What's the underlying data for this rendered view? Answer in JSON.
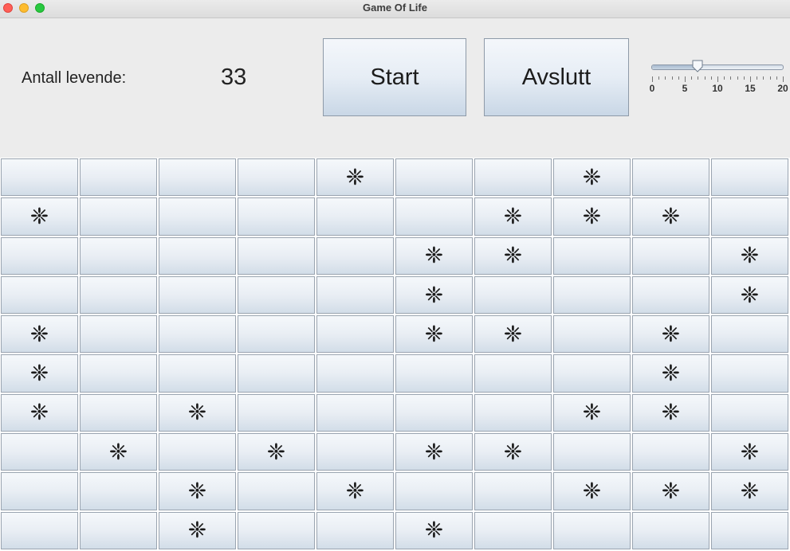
{
  "window": {
    "title": "Game Of Life"
  },
  "controls": {
    "alive_label": "Antall levende:",
    "alive_count": "33",
    "start_label": "Start",
    "quit_label": "Avslutt",
    "speed_slider": {
      "min": 0,
      "max": 20,
      "value": 7,
      "major_tick_labels": [
        "0",
        "5",
        "10",
        "15",
        "20"
      ]
    }
  },
  "grid": {
    "rows": 10,
    "cols": 10,
    "alive_symbol": "❈",
    "alive_icon": "alive-cell-icon",
    "cells": [
      [
        0,
        0,
        0,
        0,
        1,
        0,
        0,
        1,
        0,
        0
      ],
      [
        1,
        0,
        0,
        0,
        0,
        0,
        1,
        1,
        1,
        0
      ],
      [
        0,
        0,
        0,
        0,
        0,
        1,
        1,
        0,
        0,
        1
      ],
      [
        0,
        0,
        0,
        0,
        0,
        1,
        0,
        0,
        0,
        1
      ],
      [
        1,
        0,
        0,
        0,
        0,
        1,
        1,
        0,
        1,
        0
      ],
      [
        1,
        0,
        0,
        0,
        0,
        0,
        0,
        0,
        1,
        0
      ],
      [
        1,
        0,
        1,
        0,
        0,
        0,
        0,
        1,
        1,
        0
      ],
      [
        0,
        1,
        0,
        1,
        0,
        1,
        1,
        0,
        0,
        1
      ],
      [
        0,
        0,
        1,
        0,
        1,
        0,
        0,
        1,
        1,
        1
      ],
      [
        0,
        0,
        1,
        0,
        0,
        1,
        0,
        0,
        0,
        0
      ]
    ]
  },
  "colors": {
    "close": "#ff5f57",
    "minimize": "#febc2e",
    "maximize": "#28c840"
  }
}
